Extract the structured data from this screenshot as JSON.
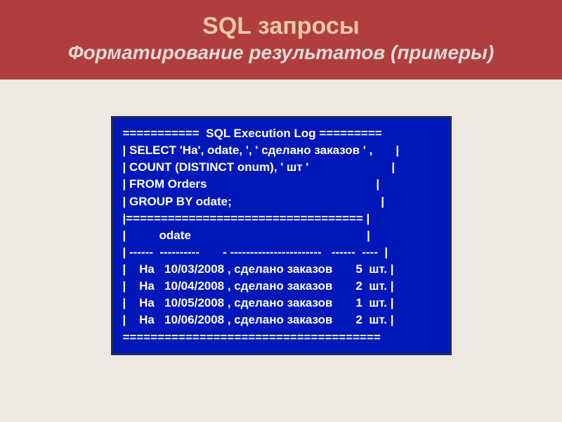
{
  "header": {
    "title": "SQL запросы",
    "subtitle": "Форматирование результатов (примеры)"
  },
  "code": {
    "lines": [
      "===========  SQL Execution Log =========",
      "| SELECT 'На', odate, ', ' сделано заказов ' ,       |",
      "| COUNT (DISTINCT onum), ' шт '                         |",
      "| FROM Orders                                                   |",
      "| GROUP BY odate;                                             |",
      "|================================== |",
      "|          odate                                                     |",
      "| ------  ----------       - -----------------------   ------  ----  |",
      "|    На   10/03/2008 , сделано заказов       5  шт. |",
      "|    На   10/04/2008 , сделано заказов       2  шт. |",
      "|    На   10/05/2008 , сделано заказов       1  шт. |",
      "|    На   10/06/2008 , сделано заказов       2  шт. |",
      "====================================="
    ]
  }
}
